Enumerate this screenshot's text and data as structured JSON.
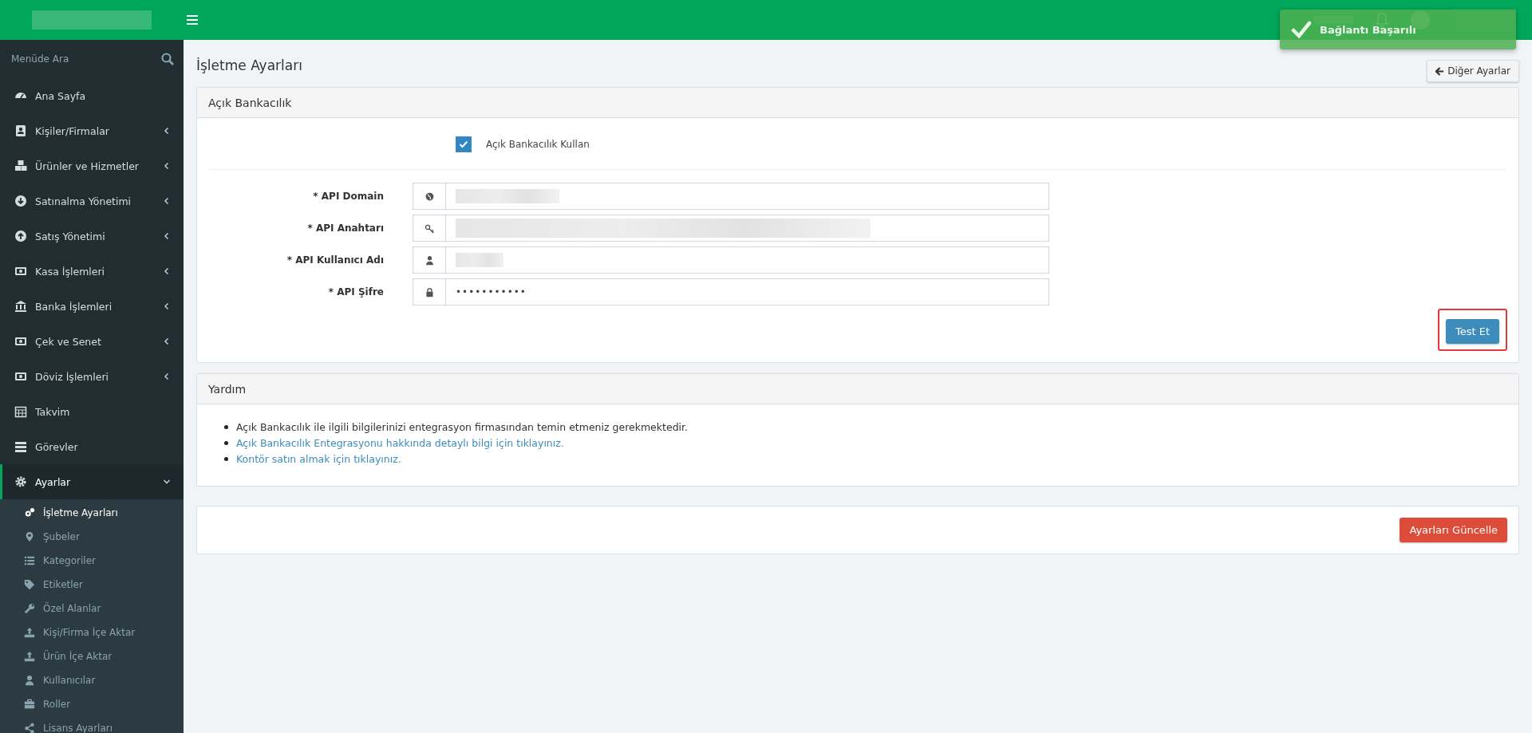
{
  "toast": {
    "message": "Bağlantı Başarılı"
  },
  "sidebar": {
    "search_placeholder": "Menüde Ara",
    "items": [
      {
        "label": "Ana Sayfa",
        "selected": false
      },
      {
        "label": "Kişiler/Firmalar",
        "expanded": false,
        "selected": false
      },
      {
        "label": "Ürünler ve Hizmetler",
        "expanded": false,
        "selected": false
      },
      {
        "label": "Satınalma Yönetimi",
        "expanded": false,
        "selected": false
      },
      {
        "label": "Satış Yönetimi",
        "expanded": false,
        "selected": false
      },
      {
        "label": "Kasa İşlemleri",
        "expanded": false,
        "selected": false
      },
      {
        "label": "Banka İşlemleri",
        "expanded": false,
        "selected": false
      },
      {
        "label": "Çek ve Senet",
        "expanded": false,
        "selected": false
      },
      {
        "label": "Döviz İşlemleri",
        "expanded": false,
        "selected": false
      },
      {
        "label": "Takvim",
        "selected": false
      },
      {
        "label": "Görevler",
        "selected": false
      },
      {
        "label": "Ayarlar",
        "expanded": true,
        "selected": true,
        "children": [
          {
            "label": "İşletme Ayarları",
            "selected": true
          },
          {
            "label": "Şubeler",
            "selected": false
          },
          {
            "label": "Kategoriler",
            "selected": false
          },
          {
            "label": "Etiketler",
            "selected": false
          },
          {
            "label": "Özel Alanlar",
            "selected": false
          },
          {
            "label": "Kişi/Firma İçe Aktar",
            "selected": false
          },
          {
            "label": "Ürün İçe Aktar",
            "selected": false
          },
          {
            "label": "Kullanıcılar",
            "selected": false
          },
          {
            "label": "Roller",
            "selected": false
          },
          {
            "label": "Lisans Ayarları",
            "selected": false
          }
        ]
      }
    ]
  },
  "page": {
    "title": "İşletme Ayarları",
    "back_button": "Diğer Ayarlar"
  },
  "open_banking_panel": {
    "title": "Açık Bankacılık",
    "use_checkbox": {
      "label": "Açık Bankacılık Kullan",
      "checked": true
    },
    "fields": [
      {
        "label": "* API Domain",
        "kind": "redacted"
      },
      {
        "label": "* API Anahtarı",
        "kind": "redacted-long"
      },
      {
        "label": "* API Kullanıcı Adı",
        "kind": "redacted-short"
      },
      {
        "label": "* API Şifre",
        "kind": "password",
        "value": "•••••••••••"
      }
    ],
    "test_button": "Test Et"
  },
  "help_panel": {
    "title": "Yardım",
    "items": [
      {
        "text": "Açık Bankacılık ile ilgili bilgilerinizi entegrasyon firmasından temin etmeniz gerekmektedir.",
        "kind": "text"
      },
      {
        "text": "Açık Bankacılık Entegrasyonu hakkında detaylı bilgi için tıklayınız.",
        "kind": "link"
      },
      {
        "text": "Kontör satın almak için tıklayınız.",
        "kind": "link"
      }
    ]
  },
  "footer_panel": {
    "update_button": "Ayarları Güncelle"
  }
}
